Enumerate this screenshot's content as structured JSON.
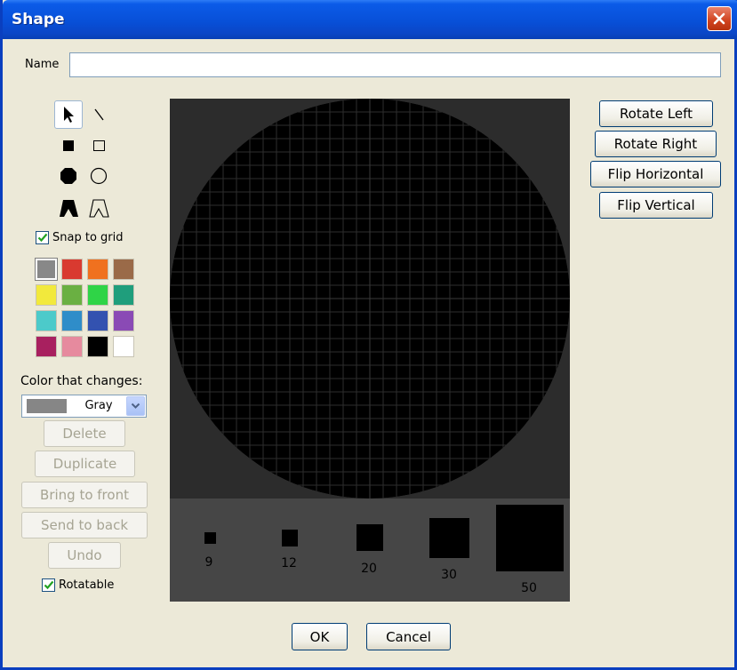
{
  "window": {
    "title": "Shape"
  },
  "name_field": {
    "label": "Name",
    "value": ""
  },
  "tools": [
    "arrow-icon",
    "line-icon",
    "filled-square-icon",
    "outline-square-icon",
    "filled-octagon-icon",
    "outline-circle-icon",
    "filled-polygon-icon",
    "outline-polygon-icon"
  ],
  "snap_to_grid": {
    "label": "Snap to grid",
    "checked": true
  },
  "palette": [
    "#888888",
    "#d93a30",
    "#f0711f",
    "#9a6a48",
    "#f2e93c",
    "#6ab042",
    "#2fd447",
    "#1f9e7c",
    "#4ccaca",
    "#2f8dc9",
    "#3352b0",
    "#8a4ab5",
    "#a8205f",
    "#e68a9e",
    "#000000",
    "#ffffff"
  ],
  "color_changes": {
    "label": "Color that changes:",
    "value": "Gray",
    "chip_color": "#868686"
  },
  "edit_buttons": {
    "delete": "Delete",
    "duplicate": "Duplicate",
    "bring_front": "Bring to front",
    "send_back": "Send to back",
    "undo": "Undo"
  },
  "rotatable": {
    "label": "Rotatable",
    "checked": true
  },
  "transform_buttons": {
    "rotate_left": "Rotate Left",
    "rotate_right": "Rotate Right",
    "flip_horizontal": "Flip Horizontal",
    "flip_vertical": "Flip Vertical"
  },
  "preview": {
    "sizes": [
      "9",
      "12",
      "20",
      "30",
      "50"
    ]
  },
  "dialog": {
    "ok": "OK",
    "cancel": "Cancel"
  }
}
